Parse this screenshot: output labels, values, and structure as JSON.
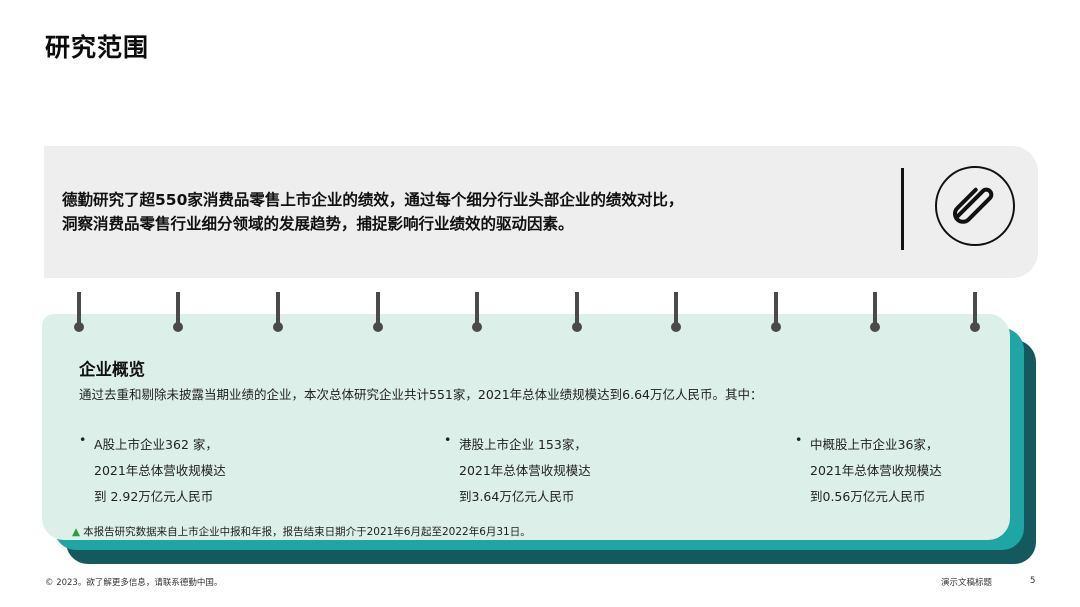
{
  "page": {
    "title": "研究范围"
  },
  "summary": {
    "line1": "德勤研究了超550家消费品零售上市企业的绩效，通过每个细分行业头部企业的绩效对比，",
    "line2": "洞察消费品零售行业细分领域的发展趋势，捕捉影响行业绩效的驱动因素。",
    "icon": "paperclip-icon"
  },
  "overview": {
    "heading": "企业概览",
    "intro": "通过去重和剔除未披露当期业绩的企业，本次总体研究企业共计551家，2021年总体业绩规模达到6.64万亿人民币。其中：",
    "bullets": [
      {
        "marker": "•",
        "lines": [
          "A股上市企业362 家，",
          "2021年总体营收规模达",
          "到 2.92万亿元人民币"
        ]
      },
      {
        "marker": "•",
        "lines": [
          "港股上市企业 153家，",
          "2021年总体营收规模达",
          "到3.64万亿元人民币"
        ]
      },
      {
        "marker": "•",
        "lines": [
          "中概股上市企业36家，",
          "2021年总体营收规模达",
          "到0.56万亿元人民币"
        ]
      }
    ],
    "footnote_marker": "▲",
    "footnote": "本报告研究数据来自上市企业中报和年报，报告结束日期介于2021年6月起至2022年6月31日。"
  },
  "footer": {
    "copyright": "© 2023。欲了解更多信息，请联系德勤中国。",
    "deck_title": "演示文稿标题",
    "page_number": "5"
  },
  "colors": {
    "card_fill": "#dcefe9",
    "teal_mid": "#1fa6a4",
    "teal_dark": "#14595d",
    "summary_fill": "#eeeeee",
    "pin": "#4a4a4a",
    "footnote_marker": "#2e9b3e"
  }
}
